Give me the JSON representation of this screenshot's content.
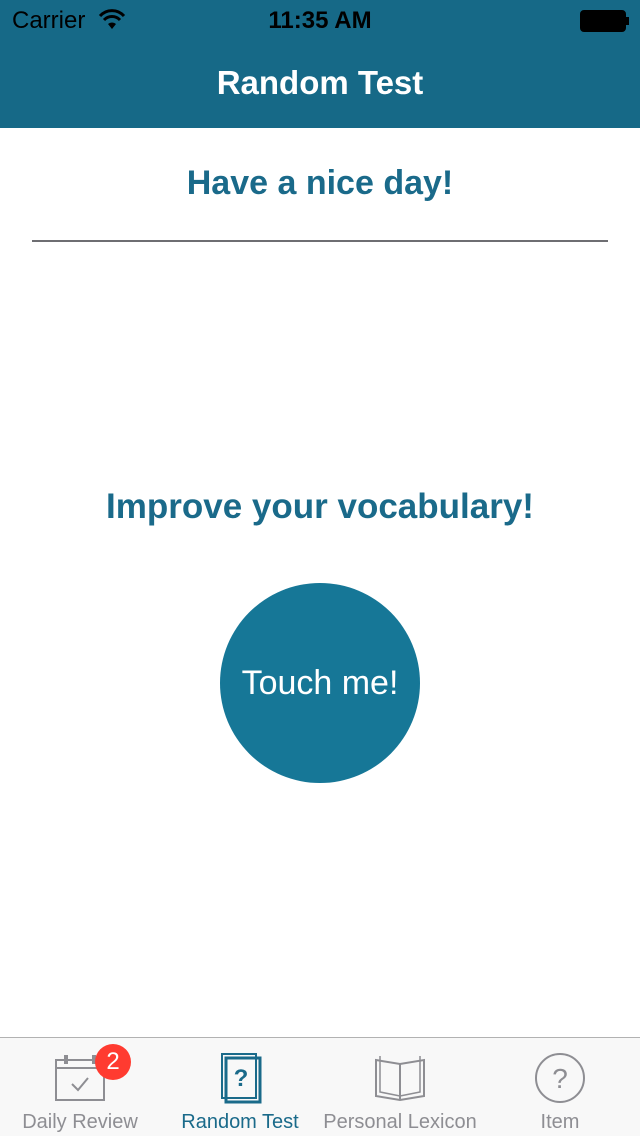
{
  "status_bar": {
    "carrier": "Carrier",
    "time": "11:35 AM",
    "icons": [
      "wifi-icon",
      "battery-icon"
    ]
  },
  "nav": {
    "title": "Random Test"
  },
  "main": {
    "greeting": "Have a nice day!",
    "subtitle": "Improve your vocabulary!",
    "button_label": "Touch me!"
  },
  "tab_bar": {
    "items": [
      {
        "label": "Daily Review",
        "icon": "calendar-check-icon",
        "badge": "2",
        "active": false
      },
      {
        "label": "Random Test",
        "icon": "question-card-icon",
        "active": true
      },
      {
        "label": "Personal Lexicon",
        "icon": "open-book-icon",
        "active": false
      },
      {
        "label": "Item",
        "icon": "question-circle-icon",
        "active": false
      }
    ]
  },
  "colors": {
    "brand": "#166987",
    "button": "#167797",
    "text_accent": "#1a6a8a",
    "badge": "#ff3b30",
    "inactive_tab": "#8e8e93"
  }
}
